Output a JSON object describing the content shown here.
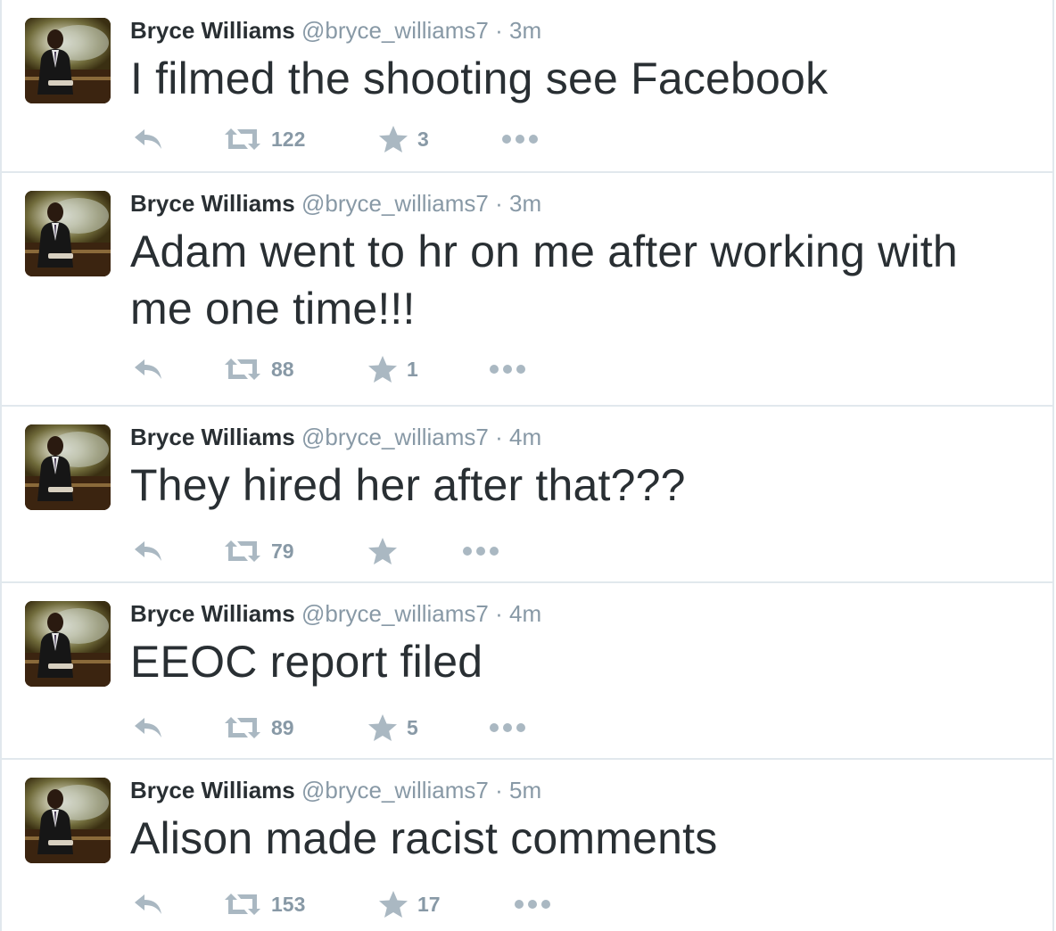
{
  "colors": {
    "text": "#292f33",
    "muted": "#8899a6",
    "icon": "#aab8c2",
    "divider": "#e1e8ed"
  },
  "icons": {
    "reply": "reply-icon",
    "retweet": "retweet-icon",
    "favorite": "star-icon",
    "more": "more-dots-icon"
  },
  "tweets": [
    {
      "fullname": "Bryce Williams",
      "username": "@bryce_williams7",
      "separator": "·",
      "time": "3m",
      "text": "I filmed the shooting see Facebook",
      "retweets": "122",
      "favorites": "3"
    },
    {
      "fullname": "Bryce Williams",
      "username": "@bryce_williams7",
      "separator": "·",
      "time": "3m",
      "text": "Adam went to hr on me after working with me one time!!!",
      "retweets": "88",
      "favorites": "1"
    },
    {
      "fullname": "Bryce Williams",
      "username": "@bryce_williams7",
      "separator": "·",
      "time": "4m",
      "text": "They hired her after that???",
      "retweets": "79",
      "favorites": ""
    },
    {
      "fullname": "Bryce Williams",
      "username": "@bryce_williams7",
      "separator": "·",
      "time": "4m",
      "text": "EEOC report filed",
      "retweets": "89",
      "favorites": "5"
    },
    {
      "fullname": "Bryce Williams",
      "username": "@bryce_williams7",
      "separator": "·",
      "time": "5m",
      "text": "Alison made racist comments",
      "retweets": "153",
      "favorites": "17"
    }
  ]
}
